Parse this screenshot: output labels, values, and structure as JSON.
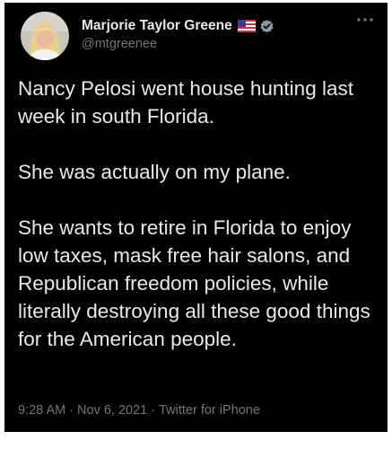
{
  "tweet": {
    "author": {
      "name": "Marjorie Taylor Greene",
      "handle": "@mtgreenee",
      "avatar_icon": "profile-photo",
      "flag_icon": "us-flag",
      "verified_icon": "verified-badge"
    },
    "more_icon": "more-options",
    "paragraphs": [
      "Nancy Pelosi went house hunting last week in south Florida.",
      "She was actually on my plane.",
      "She wants to retire in Florida to enjoy low taxes, mask free hair salons, and Republican freedom policies, while literally destroying all these good things for the American people."
    ],
    "time": "9:28 AM",
    "date": "Nov 6, 2021",
    "source": "Twitter for iPhone",
    "separator": "·"
  },
  "colors": {
    "background": "#000000",
    "text": "#e7e9ea",
    "secondary_text": "#71767b",
    "verified": "#829aab"
  }
}
